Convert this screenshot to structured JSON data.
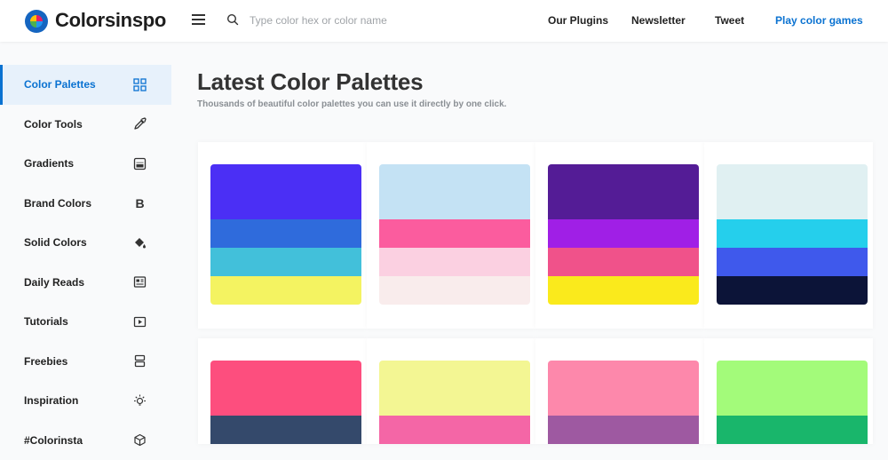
{
  "header": {
    "brand": "Colorsinspo",
    "search_placeholder": "Type color hex or color name",
    "nav": [
      "Our Plugins",
      "Newsletter",
      "Tweet",
      "Play color games"
    ],
    "accent_color": "#0a72d1"
  },
  "sidebar": {
    "items": [
      {
        "label": "Color Palettes",
        "icon": "grid-icon",
        "active": true
      },
      {
        "label": "Color Tools",
        "icon": "eyedropper-icon"
      },
      {
        "label": "Gradients",
        "icon": "gradient-icon"
      },
      {
        "label": "Brand Colors",
        "icon": "bold-b-icon"
      },
      {
        "label": "Solid Colors",
        "icon": "paint-bucket-icon"
      },
      {
        "label": "Daily Reads",
        "icon": "newspaper-icon"
      },
      {
        "label": "Tutorials",
        "icon": "play-video-icon"
      },
      {
        "label": "Freebies",
        "icon": "layers-icon"
      },
      {
        "label": "Inspiration",
        "icon": "lightbulb-icon"
      },
      {
        "label": "#Colorinsta",
        "icon": "cube-icon"
      }
    ]
  },
  "main": {
    "title": "Latest Color Palettes",
    "subtitle": "Thousands of beautiful color palettes you can use it directly by one click.",
    "palettes": [
      [
        "#4b2ff5",
        "#2f6bdc",
        "#42c0da",
        "#f4f361"
      ],
      [
        "#c4e2f4",
        "#fb5c9e",
        "#fbd0e1",
        "#f9ecec"
      ],
      [
        "#541c96",
        "#a01fe6",
        "#f0528a",
        "#faea1c"
      ],
      [
        "#e0f0f2",
        "#25cfec",
        "#3f59ec",
        "#0c1438"
      ],
      [
        "#fd4e7e",
        "#34496b"
      ],
      [
        "#f3f693",
        "#f466a6"
      ],
      [
        "#fd88ab",
        "#9e59a1"
      ],
      [
        "#a3fb7a",
        "#19b66b"
      ]
    ]
  }
}
